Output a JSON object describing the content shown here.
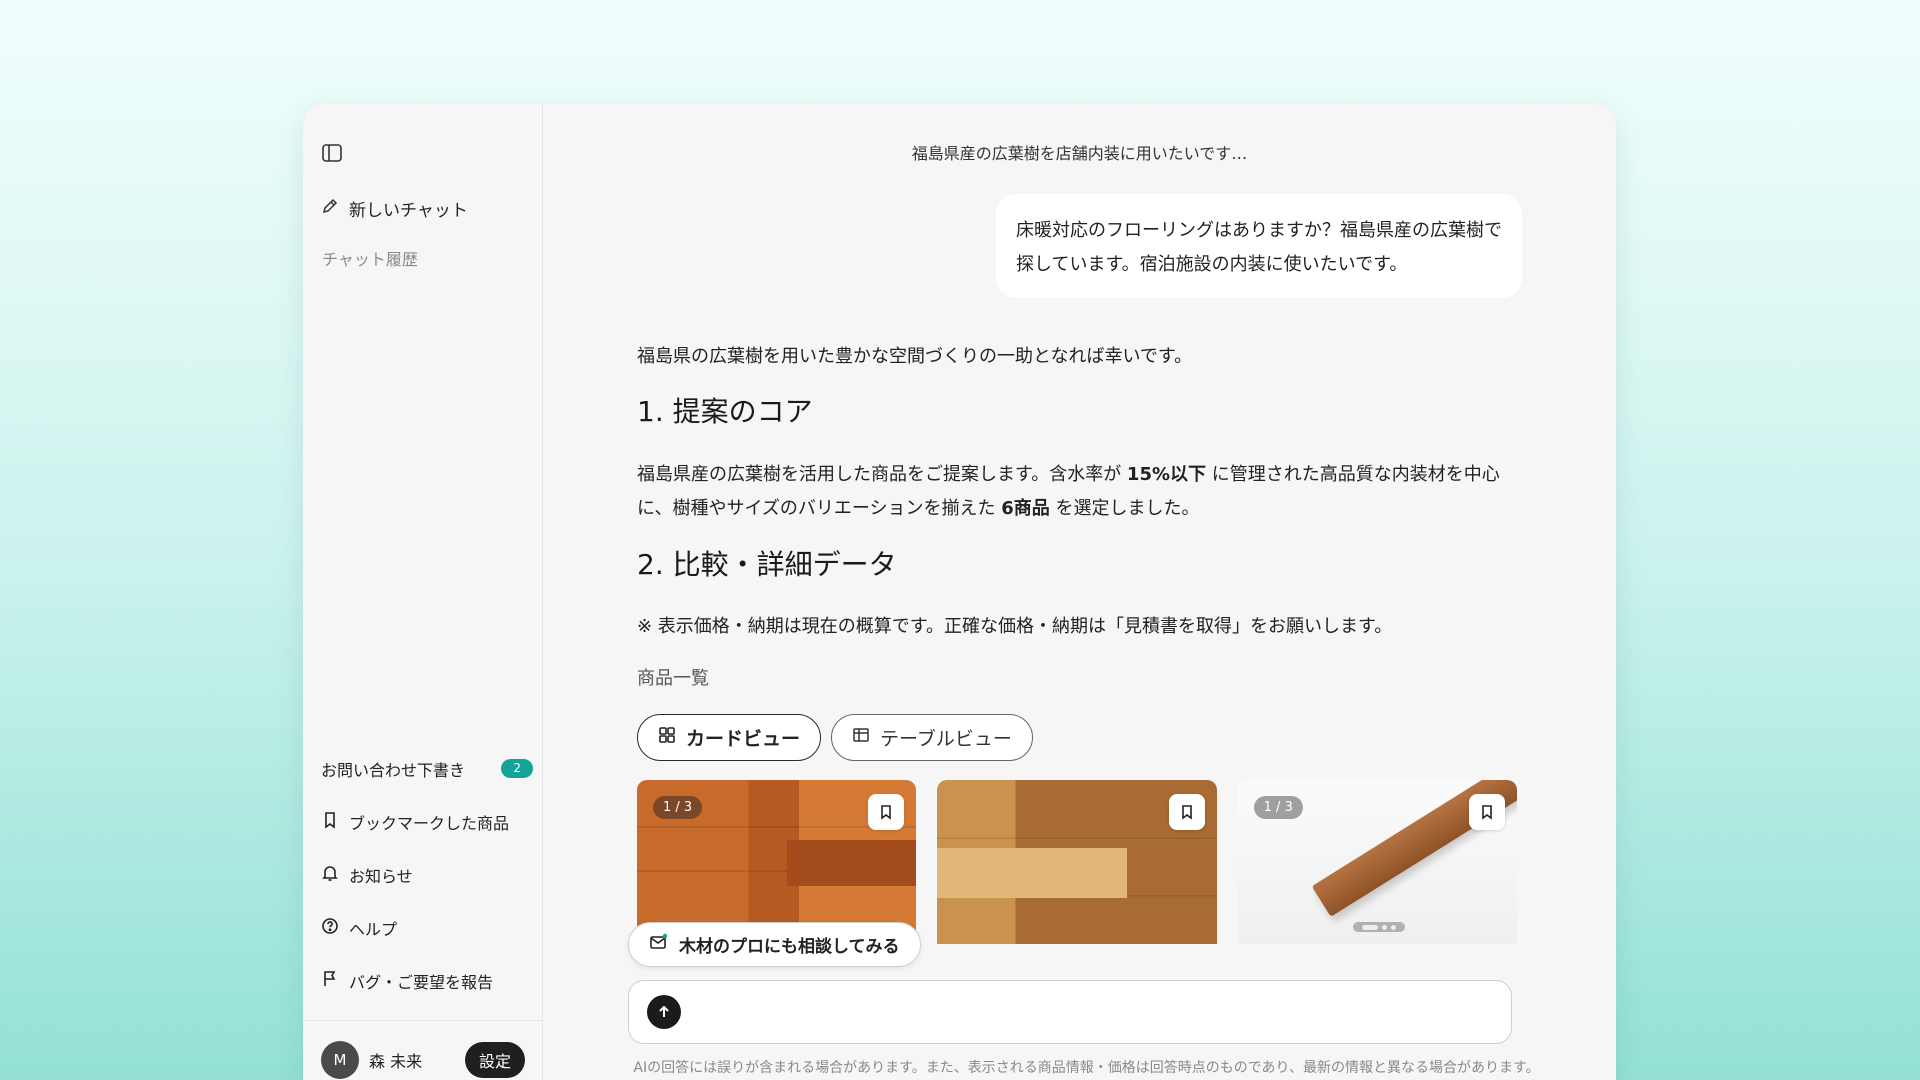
{
  "colors": {
    "accent": "#14a394",
    "dark": "#1f1f1f"
  },
  "sidebar": {
    "toggle_icon": "sidebar-toggle-icon",
    "new_chat": "新しいチャット",
    "history_label": "チャット履歴",
    "items": [
      {
        "label": "お問い合わせ下書き",
        "badge": "2",
        "icon": "draft"
      },
      {
        "label": "ブックマークした商品",
        "icon": "bookmark-icon"
      },
      {
        "label": "お知らせ",
        "icon": "bell-icon"
      },
      {
        "label": "ヘルプ",
        "icon": "help-icon"
      },
      {
        "label": "バグ・ご要望を報告",
        "icon": "flag-icon"
      }
    ],
    "user": {
      "initial": "M",
      "name": "森 未来",
      "settings": "設定"
    }
  },
  "main": {
    "title": "福島県産の広葉樹を店舗内装に用いたいです…",
    "user_message": "床暖対応のフローリングはありますか？福島県産の広葉樹で探しています。宿泊施設の内装に使いたいです。",
    "answer": {
      "intro": "福島県の広葉樹を用いた豊かな空間づくりの一助となれば幸いです。",
      "heading1": "1. 提案のコア",
      "core_text_1": "福島県産の広葉樹を活用した商品をご提案します。含水率が ",
      "core_bold_1": "15%以下",
      "core_text_2": " に管理された高品質な内装材を中心に、樹種やサイズのバリエーションを揃えた ",
      "core_bold_2": "6商品",
      "core_text_3": " を選定しました。",
      "heading2": "2. 比較・詳細データ",
      "note": "※ 表示価格・納期は現在の概算です。正確な価格・納期は「見積書を取得」をお願いします。",
      "list_label": "商品一覧"
    },
    "view_tabs": {
      "card": "カードビュー",
      "table": "テーブルビュー"
    },
    "cards": [
      {
        "counter": "1 / 3"
      },
      {
        "counter": ""
      },
      {
        "counter": "1 / 3"
      }
    ],
    "consult_button": "木材のプロにも相談してみる",
    "input_placeholder": "",
    "disclaimer": "AIの回答には誤りが含まれる場合があります。また、表示される商品情報・価格は回答時点のものであり、最新の情報と異なる場合があります。"
  }
}
